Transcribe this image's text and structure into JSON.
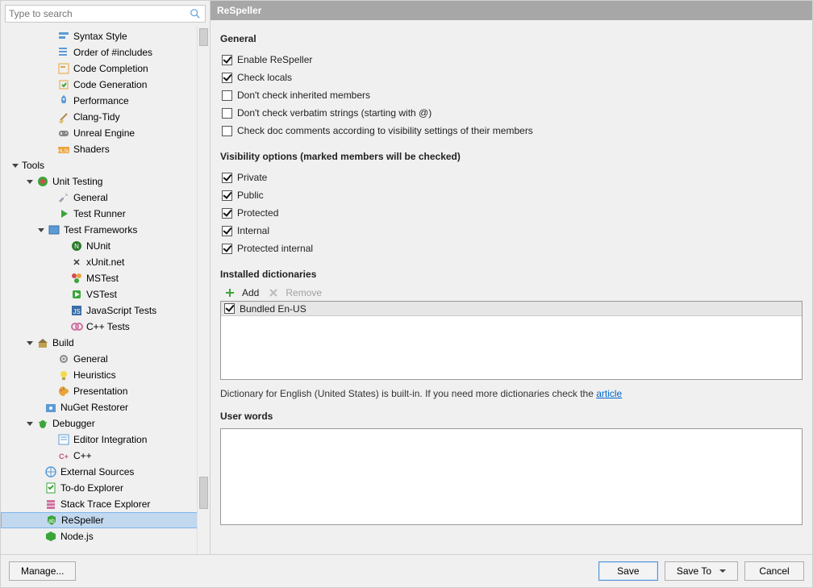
{
  "search": {
    "placeholder": "Type to search"
  },
  "tree": {
    "items": [
      {
        "indent": 56,
        "label": "Syntax Style",
        "icon": "syntax",
        "expander": "",
        "selected": false
      },
      {
        "indent": 56,
        "label": "Order of #includes",
        "icon": "order",
        "expander": "",
        "selected": false
      },
      {
        "indent": 56,
        "label": "Code Completion",
        "icon": "completion",
        "expander": "",
        "selected": false
      },
      {
        "indent": 56,
        "label": "Code Generation",
        "icon": "generation",
        "expander": "",
        "selected": false
      },
      {
        "indent": 56,
        "label": "Performance",
        "icon": "rocket",
        "expander": "",
        "selected": false
      },
      {
        "indent": 56,
        "label": "Clang-Tidy",
        "icon": "broom",
        "expander": "",
        "selected": false
      },
      {
        "indent": 56,
        "label": "Unreal Engine",
        "icon": "gamepad",
        "expander": "",
        "selected": false
      },
      {
        "indent": 56,
        "label": "Shaders",
        "icon": "hlsl",
        "expander": "",
        "selected": false
      },
      {
        "indent": 12,
        "label": "Tools",
        "icon": "",
        "expander": "down",
        "selected": false,
        "bold": false
      },
      {
        "indent": 30,
        "label": "Unit Testing",
        "icon": "unit",
        "expander": "down",
        "selected": false
      },
      {
        "indent": 56,
        "label": "General",
        "icon": "wrench",
        "expander": "",
        "selected": false
      },
      {
        "indent": 56,
        "label": "Test Runner",
        "icon": "runner",
        "expander": "",
        "selected": false
      },
      {
        "indent": 44,
        "label": "Test Frameworks",
        "icon": "frameworks",
        "expander": "down",
        "selected": false
      },
      {
        "indent": 72,
        "label": "NUnit",
        "icon": "nunit",
        "expander": "",
        "selected": false
      },
      {
        "indent": 72,
        "label": "xUnit.net",
        "icon": "xunit",
        "expander": "",
        "selected": false
      },
      {
        "indent": 72,
        "label": "MSTest",
        "icon": "mstest",
        "expander": "",
        "selected": false
      },
      {
        "indent": 72,
        "label": "VSTest",
        "icon": "vstest",
        "expander": "",
        "selected": false
      },
      {
        "indent": 72,
        "label": "JavaScript Tests",
        "icon": "js",
        "expander": "",
        "selected": false
      },
      {
        "indent": 72,
        "label": "C++ Tests",
        "icon": "cpp",
        "expander": "",
        "selected": false
      },
      {
        "indent": 30,
        "label": "Build",
        "icon": "build",
        "expander": "down",
        "selected": false
      },
      {
        "indent": 56,
        "label": "General",
        "icon": "gear",
        "expander": "",
        "selected": false
      },
      {
        "indent": 56,
        "label": "Heuristics",
        "icon": "bulb",
        "expander": "",
        "selected": false
      },
      {
        "indent": 56,
        "label": "Presentation",
        "icon": "palette",
        "expander": "",
        "selected": false
      },
      {
        "indent": 40,
        "label": "NuGet Restorer",
        "icon": "nuget",
        "expander": "",
        "selected": false
      },
      {
        "indent": 30,
        "label": "Debugger",
        "icon": "bug",
        "expander": "down",
        "selected": false
      },
      {
        "indent": 56,
        "label": "Editor Integration",
        "icon": "editor",
        "expander": "",
        "selected": false
      },
      {
        "indent": 56,
        "label": "C++",
        "icon": "cppplus",
        "expander": "",
        "selected": false
      },
      {
        "indent": 40,
        "label": "External Sources",
        "icon": "external",
        "expander": "",
        "selected": false
      },
      {
        "indent": 40,
        "label": "To-do Explorer",
        "icon": "todo",
        "expander": "",
        "selected": false
      },
      {
        "indent": 40,
        "label": "Stack Trace Explorer",
        "icon": "stack",
        "expander": "",
        "selected": false
      },
      {
        "indent": 40,
        "label": "ReSpeller",
        "icon": "respeller",
        "expander": "",
        "selected": true
      },
      {
        "indent": 40,
        "label": "Node.js",
        "icon": "node",
        "expander": "",
        "selected": false
      }
    ]
  },
  "panel": {
    "title": "ReSpeller",
    "general": {
      "heading": "General",
      "opts": [
        {
          "label": "Enable ReSpeller",
          "checked": true
        },
        {
          "label": "Check locals",
          "checked": true
        },
        {
          "label": "Don't check inherited members",
          "checked": false
        },
        {
          "label": "Don't check verbatim strings (starting with @)",
          "checked": false
        },
        {
          "label": "Check doc comments according to visibility settings of their members",
          "checked": false
        }
      ]
    },
    "visibility": {
      "heading": "Visibility options (marked members will be checked)",
      "opts": [
        {
          "label": "Private",
          "checked": true
        },
        {
          "label": "Public",
          "checked": true
        },
        {
          "label": "Protected",
          "checked": true
        },
        {
          "label": "Internal",
          "checked": true
        },
        {
          "label": "Protected internal",
          "checked": true
        }
      ]
    },
    "dictionaries": {
      "heading": "Installed dictionaries",
      "add_label": "Add",
      "remove_label": "Remove",
      "items": [
        {
          "label": "Bundled En-US",
          "checked": true
        }
      ],
      "hint_before": "Dictionary for English (United States) is built-in. If you need more dictionaries check the ",
      "hint_link": "article"
    },
    "userwords": {
      "heading": "User words"
    }
  },
  "footer": {
    "manage": "Manage...",
    "save": "Save",
    "saveto": "Save To",
    "cancel": "Cancel"
  }
}
